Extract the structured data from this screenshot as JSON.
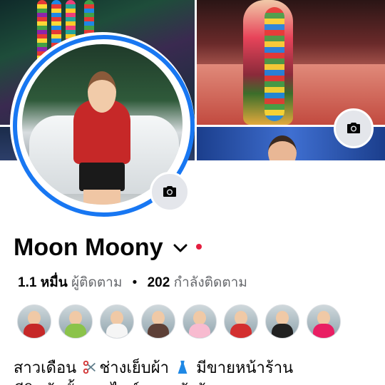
{
  "profile": {
    "name": "Moon Moony",
    "followers_count": "1.1 หมื่น",
    "followers_label": "ผู้ติดตาม",
    "separator": "•",
    "following_count": "202",
    "following_label": "กำลังติดตาม"
  },
  "bio": {
    "line1_part1": "สาวเดือน",
    "line1_part2": "ช่างเย็บผ้า",
    "line1_part3": "มีขายหน้าร้าน",
    "line2_partial": "มีสินค้าทั้งออนไลน์และหน้าร้าน"
  },
  "icons": {
    "cover_camera": "camera-icon",
    "avatar_camera": "camera-icon",
    "name_menu": "chevron-down-icon",
    "status": "red-dot",
    "bio_emoji_1": "scissors-icon",
    "bio_emoji_2": "dress-icon"
  },
  "colors": {
    "accent": "#1877f2",
    "text_primary": "#050505",
    "text_secondary": "#65676b",
    "status_dot": "#e41e3f",
    "button_bg": "#e4e6eb"
  },
  "friends": [
    {
      "color": "#c62828"
    },
    {
      "color": "#8bc34a"
    },
    {
      "color": "#f5f5f5"
    },
    {
      "color": "#5d4037"
    },
    {
      "color": "#f8bbd0"
    },
    {
      "color": "#d32f2f"
    },
    {
      "color": "#212121"
    },
    {
      "color": "#e91e63"
    }
  ]
}
